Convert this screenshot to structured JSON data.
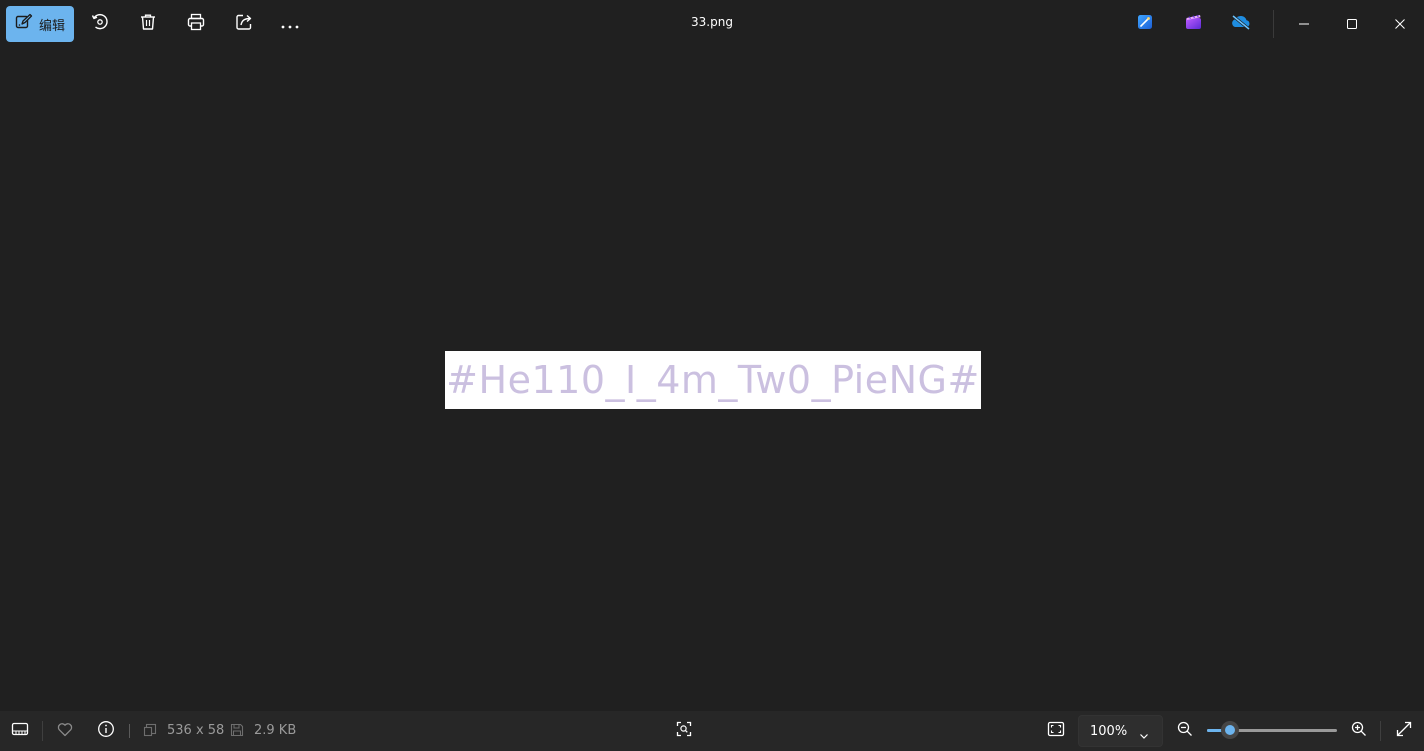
{
  "toolbar": {
    "edit_label": "编辑",
    "title": "33.png",
    "icons": [
      "edit-icon",
      "rotate-icon",
      "delete-icon",
      "print-icon",
      "share-icon",
      "more-icon"
    ],
    "app_icons": [
      "designer-icon",
      "clipchamp-icon",
      "onedrive-icon"
    ],
    "window_controls": [
      "minimize-icon",
      "maximize-icon",
      "close-icon"
    ]
  },
  "image": {
    "text": "#He110_I_4m_Tw0_PieNG#"
  },
  "statusbar": {
    "dimensions": "536 x 58",
    "file_size": "2.9 KB",
    "zoom": "100%",
    "zoom_slider_level": 0.18
  },
  "colors": {
    "accent": "#6cb4ee",
    "background": "#202020",
    "bottom_bar": "#272727",
    "image_text": "#cbc0e0"
  }
}
